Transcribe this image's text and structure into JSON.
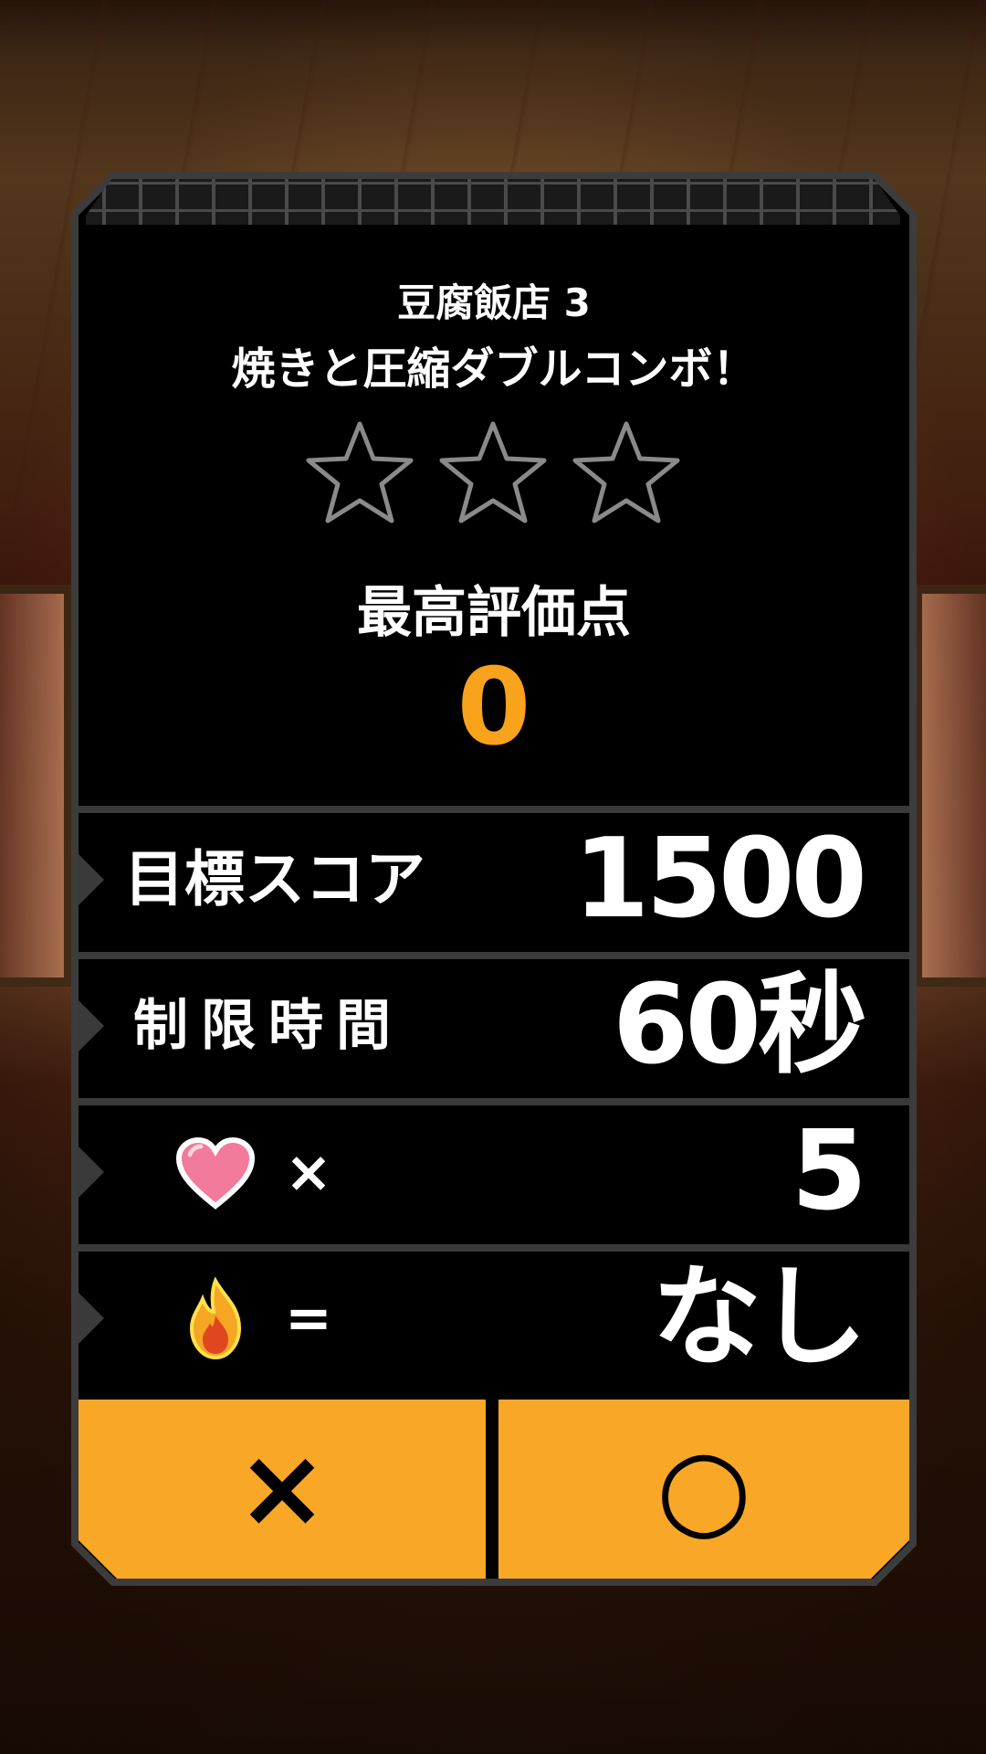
{
  "stage": {
    "title": "豆腐飯店 3",
    "subtitle": "焼きと圧縮ダブルコンボ！",
    "stars_earned": 0,
    "stars_total": 3
  },
  "best_score": {
    "label": "最高評価点",
    "value": "0"
  },
  "conditions": {
    "target_score": {
      "label": "目標スコア",
      "value": "1500"
    },
    "time_limit": {
      "label": "制限時間",
      "value": "60秒"
    },
    "lives": {
      "icon": "heart-icon",
      "operator": "×",
      "value": "5"
    },
    "fire": {
      "icon": "fire-icon",
      "operator": "=",
      "value": "なし"
    }
  },
  "buttons": {
    "cancel": "×",
    "confirm": "○"
  },
  "colors": {
    "accent": "#f9a727",
    "score": "#f9a21c",
    "panel": "#000000",
    "frame": "#3a3a3a"
  }
}
